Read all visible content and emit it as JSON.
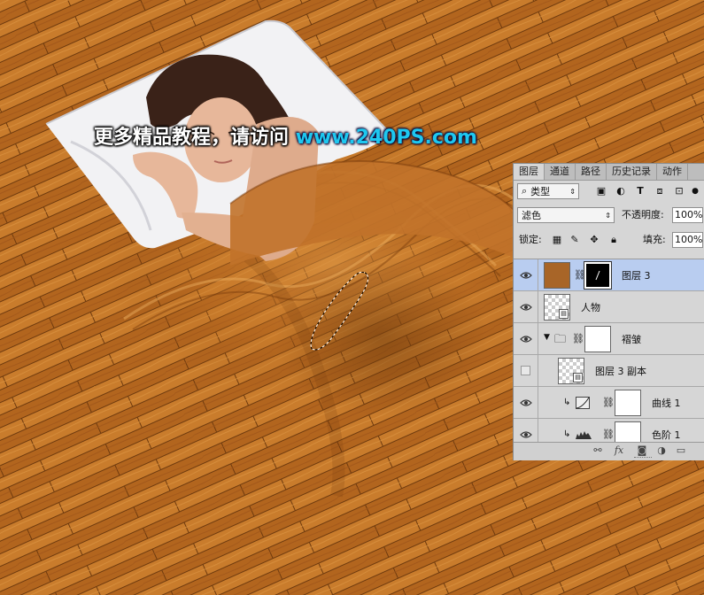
{
  "watermark": {
    "prefix": "更多精品教程，请访问",
    "url": "www.240PS.com"
  },
  "colors": {
    "wood_base": "#b8681c",
    "wood_light": "#d68a36",
    "wood_dark": "#8a4a12",
    "selected_layer": "#b9cdf0",
    "watermark_url": "#1ec8f0",
    "fill_swatch": "#a86528"
  },
  "panel": {
    "tabs": [
      "图层",
      "通道",
      "路径",
      "历史记录",
      "动作"
    ],
    "active_tab": "图层",
    "filter": {
      "search_icon": "search-icon",
      "label": "类型"
    },
    "blend_mode": "滤色",
    "opacity_label": "不透明度:",
    "opacity_value": "100%",
    "lock_label": "锁定:",
    "fill_label": "填充:",
    "fill_value": "100%",
    "layers": [
      {
        "name": "图层 3",
        "visible": true,
        "selected": true,
        "type": "fill-with-mask"
      },
      {
        "name": "人物",
        "visible": true,
        "selected": false,
        "type": "smart-object"
      },
      {
        "name": "褶皱",
        "visible": true,
        "selected": false,
        "type": "group-with-mask",
        "expanded": true
      },
      {
        "name": "图层 3 副本",
        "visible": false,
        "selected": false,
        "type": "smart-object"
      },
      {
        "name": "曲线 1",
        "visible": true,
        "selected": false,
        "type": "adjustment-clipped"
      },
      {
        "name": "色阶 1",
        "visible": true,
        "selected": false,
        "type": "adjustment-clipped"
      }
    ],
    "footer_icons": [
      "link-icon",
      "fx-icon",
      "mask-icon",
      "adjustment-icon",
      "folder-icon"
    ]
  }
}
